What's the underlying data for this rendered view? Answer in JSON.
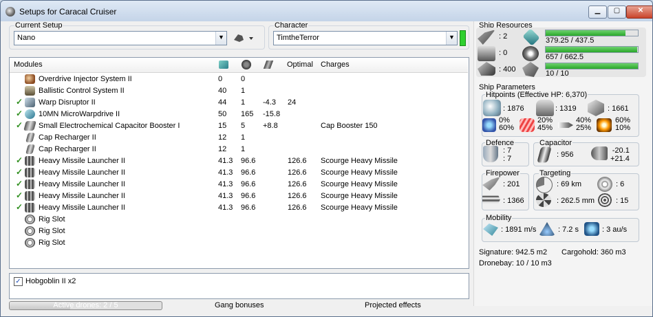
{
  "window": {
    "title": "Setups for Caracal Cruiser"
  },
  "setup": {
    "label": "Current Setup",
    "value": "Nano"
  },
  "character": {
    "label": "Character",
    "value": "TimtheTerror"
  },
  "modules": {
    "headers": [
      "Modules",
      "Optimal",
      "Charges"
    ],
    "rows": [
      {
        "checked": false,
        "name": "Overdrive Injector System II",
        "cpu": "0",
        "pg": "0",
        "cap": "",
        "optimal": "",
        "charges": "",
        "icon": "overdrive-icon"
      },
      {
        "checked": false,
        "name": "Ballistic Control System II",
        "cpu": "40",
        "pg": "1",
        "cap": "",
        "optimal": "",
        "charges": "",
        "icon": "ballistic-icon"
      },
      {
        "checked": true,
        "name": "Warp Disruptor II",
        "cpu": "44",
        "pg": "1",
        "cap": "-4.3",
        "optimal": "24",
        "charges": "",
        "icon": "warp-disruptor-icon"
      },
      {
        "checked": true,
        "name": "10MN MicroWarpdrive II",
        "cpu": "50",
        "pg": "165",
        "cap": "-15.8",
        "optimal": "",
        "charges": "",
        "icon": "microwarpdrive-icon"
      },
      {
        "checked": true,
        "name": "Small Electrochemical Capacitor Booster I",
        "cpu": "15",
        "pg": "5",
        "cap": "+8.8",
        "optimal": "",
        "charges": "Cap Booster 150",
        "icon": "cap-booster-icon"
      },
      {
        "checked": false,
        "name": "Cap Recharger II",
        "cpu": "12",
        "pg": "1",
        "cap": "",
        "optimal": "",
        "charges": "",
        "icon": "cap-recharger-icon"
      },
      {
        "checked": false,
        "name": "Cap Recharger II",
        "cpu": "12",
        "pg": "1",
        "cap": "",
        "optimal": "",
        "charges": "",
        "icon": "cap-recharger-icon"
      },
      {
        "checked": true,
        "name": "Heavy Missile Launcher II",
        "cpu": "41.3",
        "pg": "96.6",
        "cap": "",
        "optimal": "126.6",
        "charges": "Scourge Heavy Missile",
        "icon": "missile-launcher-icon"
      },
      {
        "checked": true,
        "name": "Heavy Missile Launcher II",
        "cpu": "41.3",
        "pg": "96.6",
        "cap": "",
        "optimal": "126.6",
        "charges": "Scourge Heavy Missile",
        "icon": "missile-launcher-icon"
      },
      {
        "checked": true,
        "name": "Heavy Missile Launcher II",
        "cpu": "41.3",
        "pg": "96.6",
        "cap": "",
        "optimal": "126.6",
        "charges": "Scourge Heavy Missile",
        "icon": "missile-launcher-icon"
      },
      {
        "checked": true,
        "name": "Heavy Missile Launcher II",
        "cpu": "41.3",
        "pg": "96.6",
        "cap": "",
        "optimal": "126.6",
        "charges": "Scourge Heavy Missile",
        "icon": "missile-launcher-icon"
      },
      {
        "checked": true,
        "name": "Heavy Missile Launcher II",
        "cpu": "41.3",
        "pg": "96.6",
        "cap": "",
        "optimal": "126.6",
        "charges": "Scourge Heavy Missile",
        "icon": "missile-launcher-icon"
      },
      {
        "checked": false,
        "name": "Rig Slot",
        "cpu": "",
        "pg": "",
        "cap": "",
        "optimal": "",
        "charges": "",
        "icon": "rig-slot-icon"
      },
      {
        "checked": false,
        "name": "Rig Slot",
        "cpu": "",
        "pg": "",
        "cap": "",
        "optimal": "",
        "charges": "",
        "icon": "rig-slot-icon"
      },
      {
        "checked": false,
        "name": "Rig Slot",
        "cpu": "",
        "pg": "",
        "cap": "",
        "optimal": "",
        "charges": "",
        "icon": "rig-slot-icon"
      }
    ]
  },
  "drones": {
    "item": "Hobgoblin II x2",
    "checked": true,
    "active_label": "Active drones: 2 / 5",
    "active_progress": 0.4
  },
  "bottom_tabs": {
    "gang": "Gang bonuses",
    "projected": "Projected effects"
  },
  "resources": {
    "title": "Ship Resources",
    "turrets": ": 2",
    "launchers": ": 0",
    "calibration": ": 400",
    "cpu": {
      "text": "379.25 / 437.5",
      "fraction": 0.867
    },
    "powergrid": {
      "text": "657 / 662.5",
      "fraction": 0.992
    },
    "drone_bandwidth": {
      "text": "10 / 10",
      "fraction": 1.0
    }
  },
  "parameters": {
    "title": "Ship Parameters",
    "hitpoints": {
      "title": "Hitpoints (Effective HP: 6,370)",
      "shield": ": 1876",
      "armor": ": 1319",
      "structure": ": 1661",
      "em": [
        "0%",
        "60%"
      ],
      "thermal": [
        "20%",
        "45%"
      ],
      "kinetic": [
        "40%",
        "25%"
      ],
      "explosive": [
        "60%",
        "10%"
      ]
    },
    "defence": {
      "title": "Defence",
      "a": ": 7",
      "b": ": 7"
    },
    "capacitor": {
      "title": "Capacitor",
      "amount": ": 956",
      "delta_a": "-20.1",
      "delta_b": "+21.4"
    },
    "firepower": {
      "title": "Firepower",
      "a": ": 201",
      "b": ": 1366"
    },
    "targeting": {
      "title": "Targeting",
      "range": ": 69 km",
      "targets": ": 6",
      "resolution": ": 262.5 mm",
      "scan": ": 15"
    },
    "mobility": {
      "title": "Mobility",
      "velocity": ": 1891 m/s",
      "align": ": 7.2 s",
      "warp": ": 3 au/s"
    },
    "signature": "Signature: 942.5 m2",
    "cargohold": "Cargohold: 360 m3",
    "dronebay": "Dronebay: 10 / 10 m3"
  },
  "colors": {
    "accent_green": "#2aa82a",
    "title_bar": "#c4d4e8",
    "check_green": "#2f8f1e"
  }
}
